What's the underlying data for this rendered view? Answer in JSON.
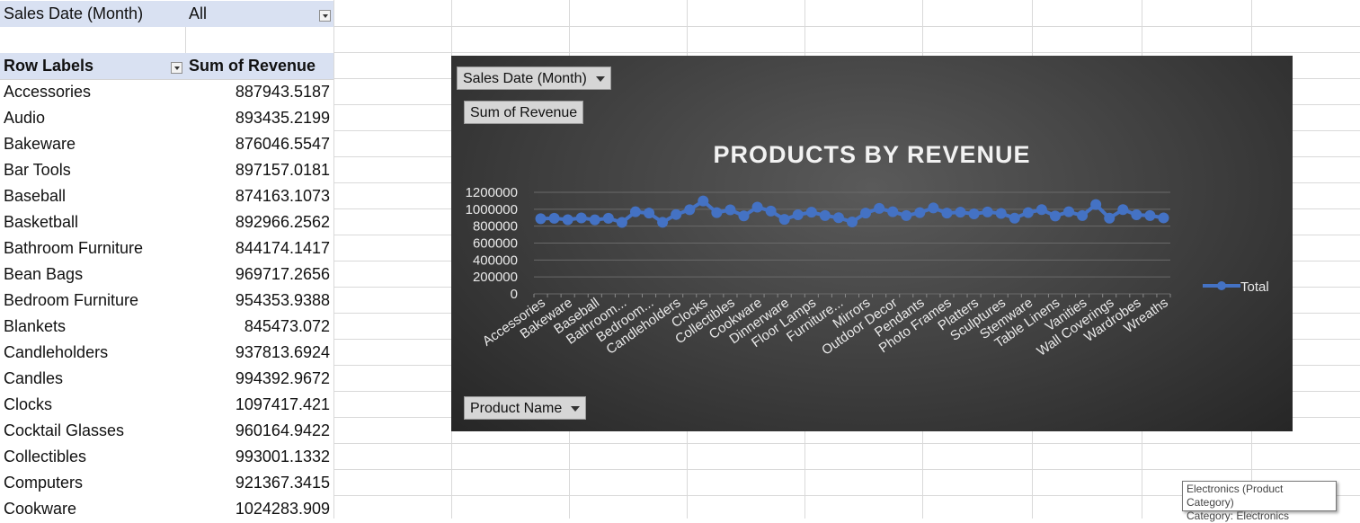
{
  "filter": {
    "label": "Sales Date (Month)",
    "value": "All"
  },
  "pivot": {
    "row_labels_header": "Row Labels",
    "value_header": "Sum of Revenue",
    "rows": [
      {
        "label": "Accessories",
        "value": "887943.5187"
      },
      {
        "label": "Audio",
        "value": "893435.2199"
      },
      {
        "label": "Bakeware",
        "value": "876046.5547"
      },
      {
        "label": "Bar Tools",
        "value": "897157.0181"
      },
      {
        "label": "Baseball",
        "value": "874163.1073"
      },
      {
        "label": "Basketball",
        "value": "892966.2562"
      },
      {
        "label": "Bathroom Furniture",
        "value": "844174.1417"
      },
      {
        "label": "Bean Bags",
        "value": "969717.2656"
      },
      {
        "label": "Bedroom Furniture",
        "value": "954353.9388"
      },
      {
        "label": "Blankets",
        "value": "845473.072"
      },
      {
        "label": "Candleholders",
        "value": "937813.6924"
      },
      {
        "label": "Candles",
        "value": "994392.9672"
      },
      {
        "label": "Clocks",
        "value": "1097417.421"
      },
      {
        "label": "Cocktail Glasses",
        "value": "960164.9422"
      },
      {
        "label": "Collectibles",
        "value": "993001.1332"
      },
      {
        "label": "Computers",
        "value": "921367.3415"
      },
      {
        "label": "Cookware",
        "value": "1024283.909"
      }
    ]
  },
  "chart": {
    "filter_button": "Sales Date (Month)",
    "value_button": "Sum of Revenue",
    "axis_button": "Product Name",
    "tooltip_line1": "Electronics (Product Category)",
    "tooltip_line2": "Category: Electronics"
  },
  "chart_data": {
    "type": "line",
    "title": "PRODUCTS BY REVENUE",
    "xlabel": "",
    "ylabel": "",
    "ylim": [
      0,
      1200000
    ],
    "y_ticks": [
      "1200000",
      "1000000",
      "800000",
      "600000",
      "400000",
      "200000",
      "0"
    ],
    "x_tick_labels": [
      "Accessories",
      "Bakeware",
      "Baseball",
      "Bathroom...",
      "Bedroom...",
      "Candleholders",
      "Clocks",
      "Collectibles",
      "Cookware",
      "Dinnerware",
      "Floor Lamps",
      "Furniture...",
      "Mirrors",
      "Outdoor Decor",
      "Pendants",
      "Photo Frames",
      "Platters",
      "Sculptures",
      "Stemware",
      "Table Linens",
      "Vanities",
      "Wall Coverings",
      "Wardrobes",
      "Wreaths"
    ],
    "grid": true,
    "legend_position": "right",
    "series": [
      {
        "name": "Total",
        "color": "#4472c4",
        "values": [
          887944,
          893435,
          876047,
          897157,
          874163,
          892966,
          844174,
          969717,
          954354,
          845473,
          937814,
          994393,
          1097417,
          960165,
          993001,
          921367,
          1024284,
          978000,
          880000,
          935000,
          965000,
          925000,
          900000,
          850000,
          955000,
          1010000,
          970000,
          925000,
          960000,
          1015000,
          955000,
          965000,
          945000,
          968000,
          950000,
          895000,
          960000,
          995000,
          920000,
          970000,
          925000,
          1055000,
          895000,
          995000,
          935000,
          925000,
          898000
        ]
      }
    ]
  }
}
